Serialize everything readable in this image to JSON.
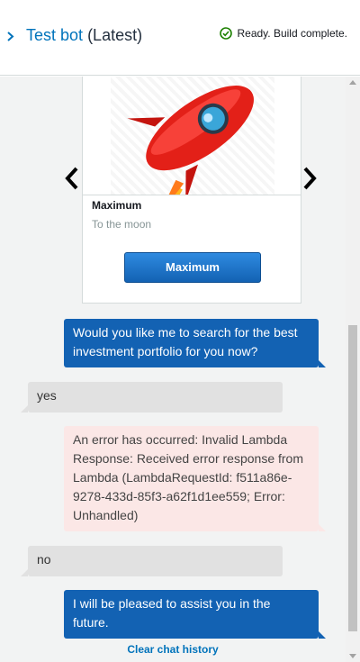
{
  "header": {
    "title_name": "Test bot",
    "title_suffix": "(Latest)",
    "status_text": "Ready. Build complete."
  },
  "colors": {
    "accent": "#0073bb",
    "bot_bubble": "#1362b3",
    "user_bubble": "#e1e1e1",
    "error_bubble": "#fbe7e6",
    "status_ok": "#1d8102"
  },
  "card": {
    "title": "Maximum",
    "subtitle": "To the moon",
    "button_label": "Maximum",
    "image_icon": "rocket-icon"
  },
  "messages": [
    {
      "sender": "bot",
      "text": "Would you like me to search for the best investment portfolio for you now?"
    },
    {
      "sender": "user",
      "text": "yes"
    },
    {
      "sender": "bot-error",
      "text": "An error has occurred: Invalid Lambda Response: Received error response from Lambda (LambdaRequestId: f511a86e-9278-433d-85f3-a62f1d1ee559; Error: Unhandled)"
    },
    {
      "sender": "user",
      "text": "no"
    },
    {
      "sender": "bot",
      "text": "I will be pleased to assist you in the future."
    }
  ],
  "footer": {
    "clear_label": "Clear chat history"
  }
}
